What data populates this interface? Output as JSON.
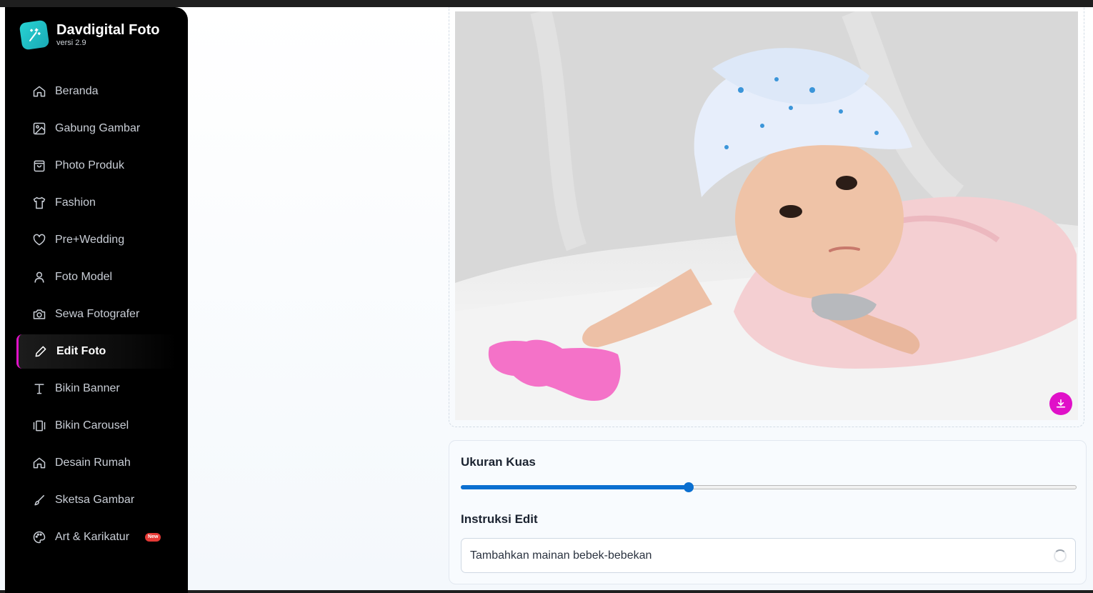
{
  "app": {
    "title": "Davdigital Foto",
    "version": "versi 2.9"
  },
  "sidebar": {
    "items": [
      {
        "label": "Beranda",
        "icon": "home-icon"
      },
      {
        "label": "Gabung Gambar",
        "icon": "image-icon"
      },
      {
        "label": "Photo Produk",
        "icon": "shopping-bag-icon"
      },
      {
        "label": "Fashion",
        "icon": "shirt-icon"
      },
      {
        "label": "Pre+Wedding",
        "icon": "heart-icon"
      },
      {
        "label": "Foto Model",
        "icon": "user-icon"
      },
      {
        "label": "Sewa Fotografer",
        "icon": "camera-icon"
      },
      {
        "label": "Edit Foto",
        "icon": "pencil-icon",
        "active": true
      },
      {
        "label": "Bikin Banner",
        "icon": "type-icon"
      },
      {
        "label": "Bikin Carousel",
        "icon": "carousel-icon"
      },
      {
        "label": "Desain Rumah",
        "icon": "house-icon"
      },
      {
        "label": "Sketsa Gambar",
        "icon": "brush-icon"
      },
      {
        "label": "Art & Karikatur",
        "icon": "palette-icon",
        "badge": "New"
      }
    ]
  },
  "editor": {
    "brush_label": "Ukuran Kuas",
    "brush_size_percent": 37,
    "instruction_label": "Instruksi Edit",
    "instruction_value": "Tambahkan mainan bebek-bebekan",
    "download_icon": "download-icon"
  },
  "colors": {
    "accent": "#e010c8",
    "slider": "#0b6fd0",
    "mask": "#f472c8"
  }
}
